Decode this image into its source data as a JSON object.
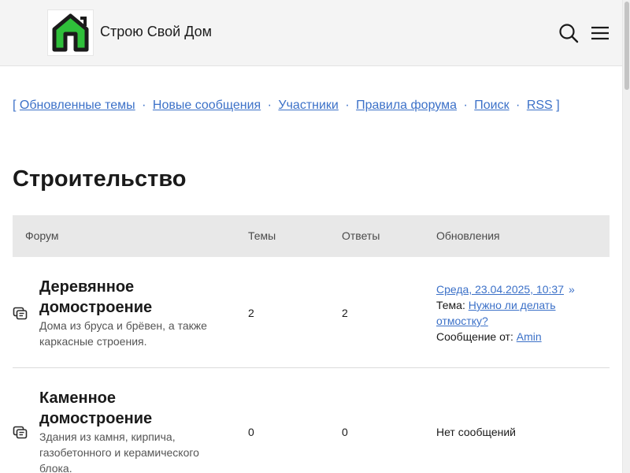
{
  "header": {
    "site_title": "Строю Свой Дом",
    "logo_icon": "house-logo-icon",
    "search_icon": "search-icon",
    "menu_icon": "hamburger-menu-icon"
  },
  "quicklinks": {
    "open_bracket": "[",
    "close_bracket": "]",
    "separator": "·",
    "items": [
      "Обновленные темы",
      "Новые сообщения",
      "Участники",
      "Правила форума",
      "Поиск",
      "RSS"
    ]
  },
  "section": {
    "title": "Строительство"
  },
  "table": {
    "headers": {
      "forum": "Форум",
      "topics": "Темы",
      "replies": "Ответы",
      "updates": "Обновления"
    },
    "rows": [
      {
        "name": "Деревянное домостроение",
        "description": "Дома из бруса и брёвен, а также каркасные строения.",
        "topics": "2",
        "replies": "2",
        "last_update": "Среда, 23.04.2025, 10:37",
        "go_icon": "»",
        "topic_label": "Тема:",
        "topic_title": "Нужно ли делать отмостку?",
        "author_label": "Сообщение от:",
        "author": "Amin"
      },
      {
        "name": "Каменное домостроение",
        "description": "Здания из камня, кирпича, газобетонного и керамического блока.",
        "topics": "0",
        "replies": "0",
        "no_messages": "Нет сообщений"
      }
    ]
  },
  "colors": {
    "link": "#3c71c8",
    "header_bg": "#f4f4f4",
    "table_head_bg": "#e8e8e8",
    "logo_green": "#2fbf3a"
  }
}
